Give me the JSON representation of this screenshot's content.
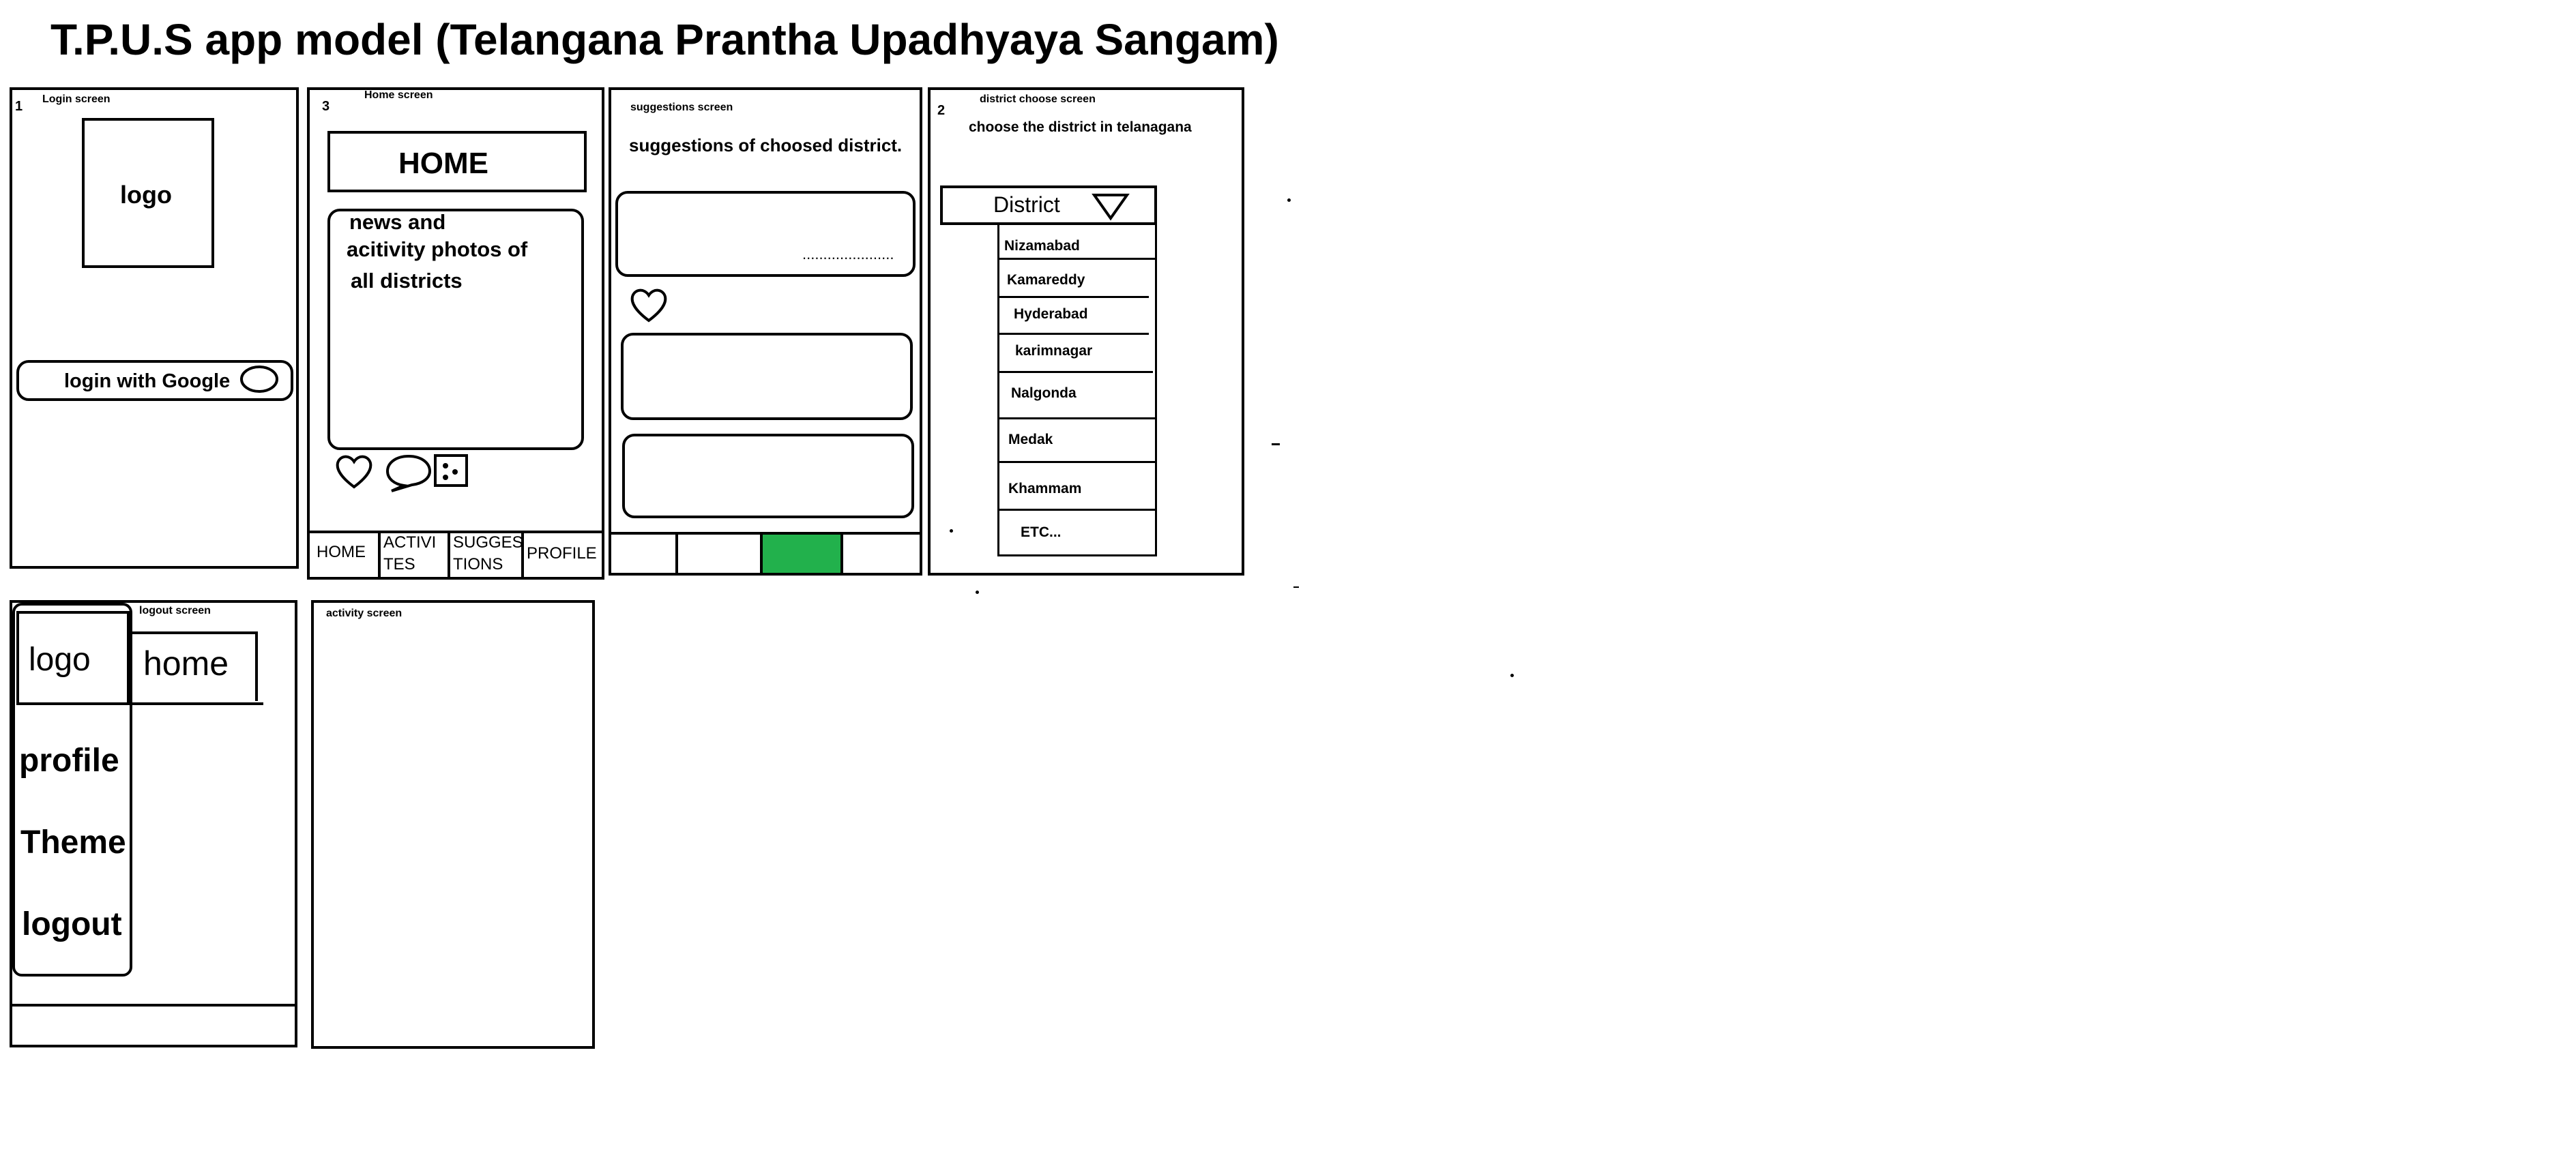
{
  "title": "T.P.U.S app model  (Telangana Prantha Upadhyaya Sangam)",
  "screens": {
    "login": {
      "number": "1",
      "label": "Login screen",
      "logo": "logo",
      "google_button": "login with Google"
    },
    "home": {
      "number": "3",
      "label": "Home screen",
      "header": "HOME",
      "feed_line1": "news and",
      "feed_line2": "acitivity photos of",
      "feed_line3": "all districts",
      "icons": [
        "heart-icon",
        "comment-icon",
        "share-icon"
      ],
      "nav": [
        {
          "line1": "HOME",
          "line2": ""
        },
        {
          "line1": "ACTIVI",
          "line2": "TES"
        },
        {
          "line1": "SUGGES",
          "line2": "TIONS"
        },
        {
          "line1": "PROFILE",
          "line2": ""
        }
      ]
    },
    "suggestions": {
      "label": "suggestions screen",
      "heading": "suggestions of choosed district.",
      "dots": "......................",
      "active_tab_color": "#22b14c"
    },
    "district": {
      "number": "2",
      "label": "district choose screen",
      "instruction": "choose the district in telanagana",
      "dropdown_label": "District",
      "options": [
        "Nizamabad",
        "Kamareddy",
        "Hyderabad",
        "karimnagar",
        "Nalgonda",
        "Medak",
        "Khammam",
        "ETC..."
      ]
    },
    "logout": {
      "label": "logout screen",
      "logo": "logo",
      "home": "home",
      "menu": [
        "profile",
        "Theme",
        "logout"
      ]
    },
    "activity": {
      "label": "activity screen"
    }
  }
}
